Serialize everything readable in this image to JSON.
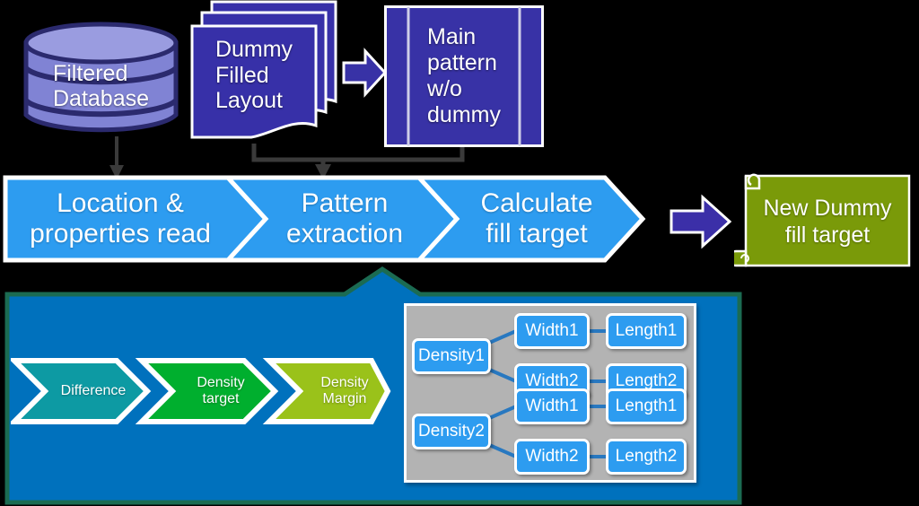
{
  "diagram": {
    "title": "Dummy fill target calculation flow",
    "colors": {
      "database_fill": "#8083d4",
      "database_stroke": "#2b2a6e",
      "document_fill": "#3730a8",
      "mainbox_fill": "#3832a6",
      "chevron_blue": "#2d9cf0",
      "panel_blue": "#0071bd",
      "panel_border": "#1b6b52",
      "scroll_green": "#7a9a09",
      "arrow_purple": "#3b2fa8",
      "difference_teal": "#0d9aa3",
      "density_target_green": "#00af2e",
      "density_margin_green": "#9ac21a",
      "tree_panel_gray": "#b3b3b3",
      "node_blue": "#2d9cf0",
      "connector_blue": "#2878c0",
      "connector_dark": "#3a3a3a"
    }
  },
  "top_row": {
    "database": {
      "label": "Filtered\nDatabase",
      "line1": "Filtered",
      "line2": "Database"
    },
    "document_stack": {
      "label": "Dummy Filled Layout",
      "line1": "Dummy",
      "line2": "Filled",
      "line3": "Layout",
      "copies": 3
    },
    "stack_arrow": {
      "name": "right-arrow",
      "direction": "right"
    },
    "main_pattern": {
      "label": "Main pattern w/o dummy",
      "line1": "Main",
      "line2": "pattern",
      "line3": "w/o",
      "line4": "dummy"
    }
  },
  "process_band": {
    "steps": [
      {
        "id": "location",
        "line1": "Location &",
        "line2": "properties read"
      },
      {
        "id": "pattern",
        "line1": "Pattern",
        "line2": "extraction"
      },
      {
        "id": "calculate",
        "line1": "Calculate",
        "line2": "fill target"
      }
    ]
  },
  "result_arrow": {
    "name": "right-arrow",
    "direction": "right"
  },
  "result": {
    "line1": "New Dummy",
    "line2": "fill target",
    "label": "New Dummy fill target"
  },
  "detail_panel": {
    "chevrons": [
      {
        "id": "difference",
        "line1": "Difference",
        "line2": "",
        "color": "#0d9aa3"
      },
      {
        "id": "density-target",
        "line1": "Density",
        "line2": "target",
        "color": "#00af2e"
      },
      {
        "id": "density-margin",
        "line1": "Density",
        "line2": "Margin",
        "color": "#9ac21a"
      }
    ],
    "tree": {
      "groups": [
        {
          "root": "Density1",
          "branches": [
            {
              "width": "Width1",
              "length": "Length1"
            },
            {
              "width": "Width2",
              "length": "Length2"
            }
          ]
        },
        {
          "root": "Density2",
          "branches": [
            {
              "width": "Width1",
              "length": "Length1"
            },
            {
              "width": "Width2",
              "length": "Length2"
            }
          ]
        }
      ]
    }
  }
}
